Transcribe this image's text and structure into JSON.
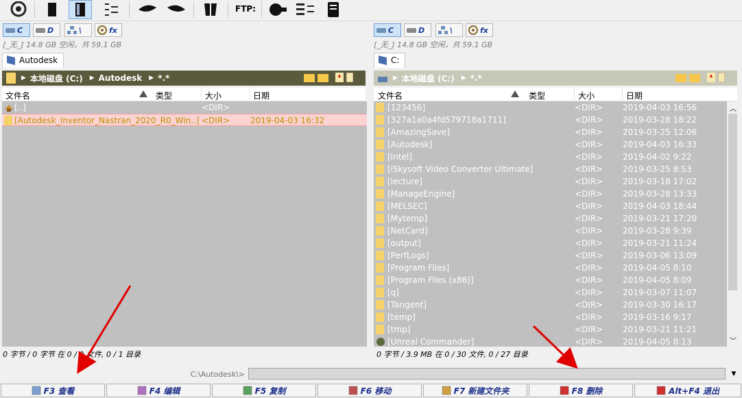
{
  "toolbar": {
    "ftp_label": "FTP:",
    "icons": [
      "refresh-icon",
      "brief-view-icon",
      "full-view-icon",
      "tree-view-icon",
      "back-icon",
      "forward-icon",
      "pack-icon",
      "ftp-connect-icon",
      "sync-dirs-icon",
      "multi-rename-icon"
    ]
  },
  "left": {
    "drives": [
      {
        "letter": "C",
        "active": true
      },
      {
        "letter": "D",
        "active": false
      },
      {
        "letter": "\\",
        "active": false
      },
      {
        "letter": "fx",
        "active": false
      }
    ],
    "free_space": "[_无_] 14.8 GB 空闲，共 59.1 GB",
    "tab": "Autodesk",
    "path": {
      "drive": "本地磁盘 (C:)",
      "folder": "Autodesk",
      "filter": "*.*"
    },
    "columns": {
      "name": "文件名",
      "type": "类型",
      "size": "大小",
      "date": "日期"
    },
    "rows": [
      {
        "name": "[..]",
        "size": "<DIR>",
        "date": "",
        "icon": "up",
        "selected": false
      },
      {
        "name": "[Autodesk_Inventor_Nastran_2020_R0_Win..]",
        "size": "<DIR>",
        "date": "2019-04-03 16:32",
        "icon": "folder",
        "selected": true
      }
    ],
    "status": "0 字节 / 0 字节 在 0 / 0 文件, 0 / 1 目录"
  },
  "right": {
    "drives": [
      {
        "letter": "C",
        "active": true
      },
      {
        "letter": "D",
        "active": false
      },
      {
        "letter": "\\",
        "active": false
      },
      {
        "letter": "fx",
        "active": false
      }
    ],
    "free_space": "[_无_] 14.8 GB 空闲，共 59.1 GB",
    "tab": "C:",
    "path": {
      "drive": "本地磁盘 (C:)",
      "filter": "*.*"
    },
    "columns": {
      "name": "文件名",
      "type": "类型",
      "size": "大小",
      "date": "日期"
    },
    "rows": [
      {
        "name": "[123456]",
        "size": "<DIR>",
        "date": "2019-04-03 16:56"
      },
      {
        "name": "[327a1a0a4fd579718a1711]",
        "size": "<DIR>",
        "date": "2019-03-28 18:22"
      },
      {
        "name": "[AmazingSave]",
        "size": "<DIR>",
        "date": "2019-03-25 12:06"
      },
      {
        "name": "[Autodesk]",
        "size": "<DIR>",
        "date": "2019-04-03 16:33"
      },
      {
        "name": "[Intel]",
        "size": "<DIR>",
        "date": "2019-04-02 9:22"
      },
      {
        "name": "[iSkysoft Video Converter Ultimate]",
        "size": "<DIR>",
        "date": "2019-03-25 8:53"
      },
      {
        "name": "[lecture]",
        "size": "<DIR>",
        "date": "2019-03-18 17:02"
      },
      {
        "name": "[ManageEngine]",
        "size": "<DIR>",
        "date": "2019-03-28 13:33"
      },
      {
        "name": "[MELSEC]",
        "size": "<DIR>",
        "date": "2019-04-03 18:44"
      },
      {
        "name": "[Mytemp]",
        "size": "<DIR>",
        "date": "2019-03-21 17:20"
      },
      {
        "name": "[NetCard]",
        "size": "<DIR>",
        "date": "2019-03-28 9:39"
      },
      {
        "name": "[output]",
        "size": "<DIR>",
        "date": "2019-03-21 11:24"
      },
      {
        "name": "[PerfLogs]",
        "size": "<DIR>",
        "date": "2019-03-06 13:09"
      },
      {
        "name": "[Program Files]",
        "size": "<DIR>",
        "date": "2019-04-05 8:10"
      },
      {
        "name": "[Program Files (x86)]",
        "size": "<DIR>",
        "date": "2019-04-05 8:09"
      },
      {
        "name": "[q]",
        "size": "<DIR>",
        "date": "2019-03-07 11:07"
      },
      {
        "name": "[Tangent]",
        "size": "<DIR>",
        "date": "2019-03-30 16:17"
      },
      {
        "name": "[temp]",
        "size": "<DIR>",
        "date": "2019-03-16 9:17"
      },
      {
        "name": "[tmp]",
        "size": "<DIR>",
        "date": "2019-03-21 11:21"
      },
      {
        "name": "[Unreal Commander]",
        "size": "<DIR>",
        "date": "2019-04-05 8:13"
      }
    ],
    "status": "0 字节 / 3.9 MB 在 0 / 30 文件, 0 / 27 目录"
  },
  "cmdline": {
    "prompt": "C:\\Autodesk\\>"
  },
  "fnkeys": [
    {
      "label": "F3 查看",
      "icon": "view-icon"
    },
    {
      "label": "F4 编辑",
      "icon": "edit-icon"
    },
    {
      "label": "F5 复制",
      "icon": "copy-icon"
    },
    {
      "label": "F6 移动",
      "icon": "move-icon"
    },
    {
      "label": "F7 新建文件夹",
      "icon": "new-folder-icon"
    },
    {
      "label": "F8 删除",
      "icon": "delete-icon"
    },
    {
      "label": "Alt+F4 退出",
      "icon": "exit-icon"
    }
  ],
  "colors": {
    "list_bg": "#c0c0c0",
    "selected_bg": "#fbd3d3",
    "selected_fg": "#c09000",
    "fn_text": "#1c2f8a",
    "path_left": "#5a5a3c",
    "arrow": "#e00000"
  }
}
